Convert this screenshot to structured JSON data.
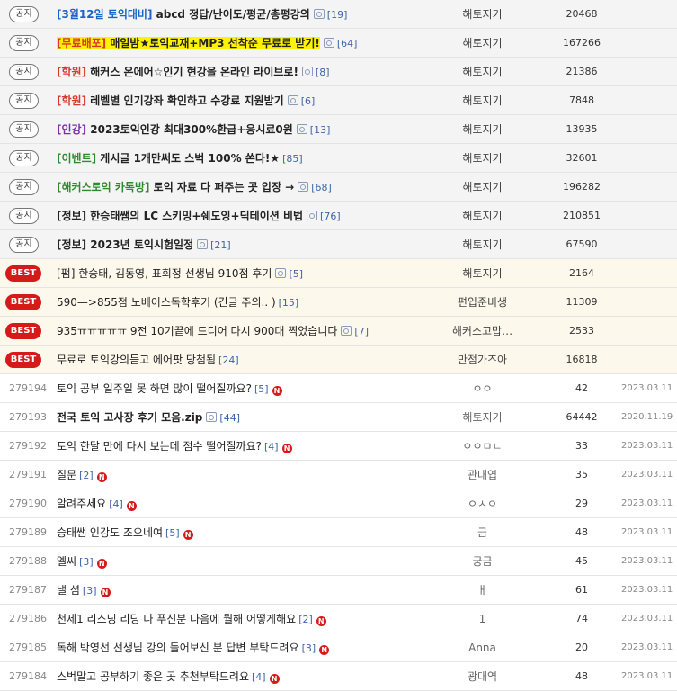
{
  "colors": {
    "prefix_blue": "#1a63c9",
    "prefix_red": "#d9362c",
    "prefix_purple": "#7a2fa5",
    "prefix_green": "#2e8a2e",
    "prefix_black": "#222222",
    "best": "#d51a1a",
    "comment": "#3e64a8"
  },
  "badges": {
    "notice": "공지",
    "best": "BEST",
    "new": "N"
  },
  "notices": [
    {
      "prefix": "[3월12일 토익대비]",
      "prefix_color": "prefix_blue",
      "text": "abcd 정답/난이도/평균/총평강의",
      "image": true,
      "comments": "[19]",
      "author": "해토지기",
      "views": "20468",
      "highlight": false
    },
    {
      "prefix": "[무료배포]",
      "prefix_color": "prefix_red",
      "text": "매일밤★토익교재+MP3 선착순 무료로 받기!",
      "image": true,
      "comments": "[64]",
      "author": "해토지기",
      "views": "167266",
      "highlight": true
    },
    {
      "prefix": "[학원]",
      "prefix_color": "prefix_red",
      "text": "해커스 온에어☆인기 현강을 온라인 라이브로!",
      "image": true,
      "comments": "[8]",
      "author": "해토지기",
      "views": "21386",
      "highlight": false
    },
    {
      "prefix": "[학원]",
      "prefix_color": "prefix_red",
      "text": "레벨별 인기강좌 확인하고 수강료 지원받기",
      "image": true,
      "comments": "[6]",
      "author": "해토지기",
      "views": "7848",
      "highlight": false
    },
    {
      "prefix": "[인강]",
      "prefix_color": "prefix_purple",
      "text": "2023토익인강 최대300%환급+응시료0원",
      "image": true,
      "comments": "[13]",
      "author": "해토지기",
      "views": "13935",
      "highlight": false
    },
    {
      "prefix": "[이벤트]",
      "prefix_color": "prefix_green",
      "text": "게시글 1개만써도 스벅 100% 쏜다!★",
      "image": false,
      "comments": "[85]",
      "author": "해토지기",
      "views": "32601",
      "highlight": false
    },
    {
      "prefix": "[해커스토익 카톡방]",
      "prefix_color": "prefix_green",
      "text": "토익 자료 다 퍼주는 곳 입장 →",
      "image": true,
      "comments": "[68]",
      "author": "해토지기",
      "views": "196282",
      "highlight": false
    },
    {
      "prefix": "[정보]",
      "prefix_color": "prefix_black",
      "text": "한승태쌤의 LC 스키밍+쉐도잉+딕테이션 비법",
      "image": true,
      "comments": "[76]",
      "author": "해토지기",
      "views": "210851",
      "highlight": false
    },
    {
      "prefix": "[정보]",
      "prefix_color": "prefix_black",
      "text": "2023년 토익시험일정",
      "image": true,
      "comments": "[21]",
      "author": "해토지기",
      "views": "67590",
      "highlight": false
    }
  ],
  "best": [
    {
      "title": "[펌] 한승태, 김동영, 표회정 선생님 910점 후기",
      "image": true,
      "comments": "[5]",
      "author": "해토지기",
      "views": "2164"
    },
    {
      "title": "590—>855점 노베이스독학후기 (긴글 주의.. )",
      "image": false,
      "comments": "[15]",
      "author": "편입준비생",
      "views": "11309"
    },
    {
      "title": "935ㅠㅠㅠㅠㅠ 9전 10기끝에 드디어 다시 900대 찍었습니다",
      "image": true,
      "comments": "[7]",
      "author": "해커스고맙…",
      "views": "2533"
    },
    {
      "title": "무료로 토익강의듣고 에어팟 당첨됨",
      "image": false,
      "comments": "[24]",
      "author": "만점가즈아",
      "views": "16818"
    }
  ],
  "posts": [
    {
      "num": "279194",
      "title": "토익 공부 일주일 못 하면 많이 떨어질까요?",
      "bold": false,
      "image": false,
      "comments": "[5]",
      "new": true,
      "author": "ㅇㅇ",
      "views": "42",
      "date": "2023.03.11"
    },
    {
      "num": "279193",
      "title": "전국 토익 고사장 후기 모음.zip",
      "bold": true,
      "image": true,
      "comments": "[44]",
      "new": false,
      "author": "해토지기",
      "views": "64442",
      "date": "2020.11.19"
    },
    {
      "num": "279192",
      "title": "토익 한달 만에 다시 보는데 점수 떨어질까요?",
      "bold": false,
      "image": false,
      "comments": "[4]",
      "new": true,
      "author": "ㅇㅇㅁㄴ",
      "views": "33",
      "date": "2023.03.11"
    },
    {
      "num": "279191",
      "title": "질문",
      "bold": false,
      "image": false,
      "comments": "[2]",
      "new": true,
      "author": "관대엽",
      "views": "35",
      "date": "2023.03.11"
    },
    {
      "num": "279190",
      "title": "알려주세요",
      "bold": false,
      "image": false,
      "comments": "[4]",
      "new": true,
      "author": "ㅇㅅㅇ",
      "views": "29",
      "date": "2023.03.11"
    },
    {
      "num": "279189",
      "title": "승태쌤 인강도 조으네여",
      "bold": false,
      "image": false,
      "comments": "[5]",
      "new": true,
      "author": "금",
      "views": "48",
      "date": "2023.03.11"
    },
    {
      "num": "279188",
      "title": "엘씨",
      "bold": false,
      "image": false,
      "comments": "[3]",
      "new": true,
      "author": "궁금",
      "views": "45",
      "date": "2023.03.11"
    },
    {
      "num": "279187",
      "title": "낼 셤",
      "bold": false,
      "image": false,
      "comments": "[3]",
      "new": true,
      "author": "ㅐ",
      "views": "61",
      "date": "2023.03.11"
    },
    {
      "num": "279186",
      "title": "천제1 리스닝 리딩 다 푸신분 다음에 뭘해 어떻게해요",
      "bold": false,
      "image": false,
      "comments": "[2]",
      "new": true,
      "author": "1",
      "views": "74",
      "date": "2023.03.11"
    },
    {
      "num": "279185",
      "title": "독해 박영선 선생님 강의 들어보신 분 답변 부탁드려요",
      "bold": false,
      "image": false,
      "comments": "[3]",
      "new": true,
      "author": "Anna",
      "views": "20",
      "date": "2023.03.11"
    },
    {
      "num": "279184",
      "title": "스벅말고 공부하기 좋은 곳 추천부탁드려요",
      "bold": false,
      "image": false,
      "comments": "[4]",
      "new": true,
      "author": "광대역",
      "views": "48",
      "date": "2023.03.11"
    }
  ]
}
